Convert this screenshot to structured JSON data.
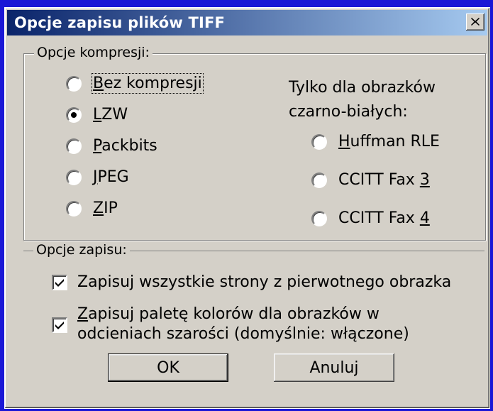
{
  "dialog": {
    "title": "Opcje zapisu plików TIFF",
    "close_icon": "close-icon"
  },
  "compression": {
    "legend": "Opcje kompresji:",
    "options": [
      {
        "pre": "",
        "key": "B",
        "post": "ez kompresji",
        "checked": false
      },
      {
        "pre": "",
        "key": "L",
        "post": "ZW",
        "checked": true
      },
      {
        "pre": "",
        "key": "P",
        "post": "ackbits",
        "checked": false
      },
      {
        "pre": "",
        "key": "J",
        "post": "PEG",
        "checked": false
      },
      {
        "pre": "",
        "key": "Z",
        "post": "IP",
        "checked": false
      }
    ],
    "bw_note_line1": "Tylko dla obrazków",
    "bw_note_line2": "czarno-białych:",
    "bw_options": [
      {
        "pre": "",
        "key": "H",
        "post": "uffman RLE",
        "checked": false
      },
      {
        "pre": "CCITT Fax ",
        "key": "3",
        "post": "",
        "checked": false
      },
      {
        "pre": "CCITT Fax ",
        "key": "4",
        "post": "",
        "checked": false
      }
    ]
  },
  "save": {
    "legend": "Opcje zapisu:",
    "save_all_pages": {
      "label": "Zapisuj wszystkie strony z pierwotnego obrazka",
      "checked": true
    },
    "save_palette": {
      "line1_key": "Z",
      "line1_rest": "apisuj paletę kolorów dla obrazków w",
      "line2": "odcieniach szarości (domyślnie: włączone)",
      "checked": true
    }
  },
  "buttons": {
    "ok": "OK",
    "cancel": "Anuluj"
  }
}
